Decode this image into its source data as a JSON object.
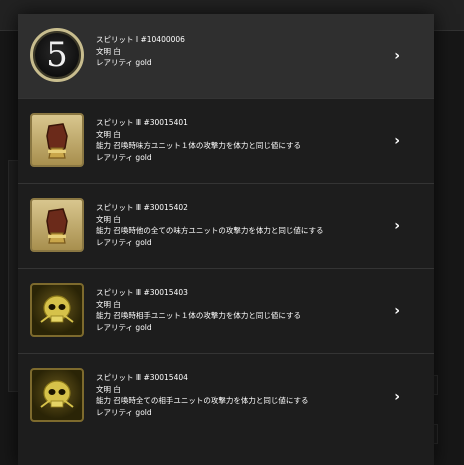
{
  "items": [
    {
      "icon": "spirit-number-5-icon",
      "badge_number": "5",
      "title": "スピリット Ⅰ #10400006",
      "lines": [
        "文明 白",
        "レアリティ gold"
      ],
      "selected": true
    },
    {
      "icon": "golden-gauntlet-icon",
      "title": "スピリット Ⅲ #30015401",
      "lines": [
        "文明 白",
        "能力 召喚時味方ユニット１体の攻撃力を体力と同じ値にする",
        "レアリティ gold"
      ],
      "selected": false
    },
    {
      "icon": "golden-gauntlet-icon",
      "title": "スピリット Ⅲ #30015402",
      "lines": [
        "文明 白",
        "能力 召喚時他の全ての味方ユニットの攻撃力を体力と同じ値にする",
        "レアリティ gold"
      ],
      "selected": false
    },
    {
      "icon": "glowing-skull-icon",
      "title": "スピリット Ⅲ #30015403",
      "lines": [
        "文明 白",
        "能力 召喚時相手ユニット１体の攻撃力を体力と同じ値にする",
        "レアリティ gold"
      ],
      "selected": false
    },
    {
      "icon": "glowing-skull-icon",
      "title": "スピリット Ⅲ #30015404",
      "lines": [
        "文明 白",
        "能力 召喚時全ての相手ユニットの攻撃力を体力と同じ値にする",
        "レアリティ gold"
      ],
      "selected": false
    }
  ],
  "arrow_glyph": "›"
}
